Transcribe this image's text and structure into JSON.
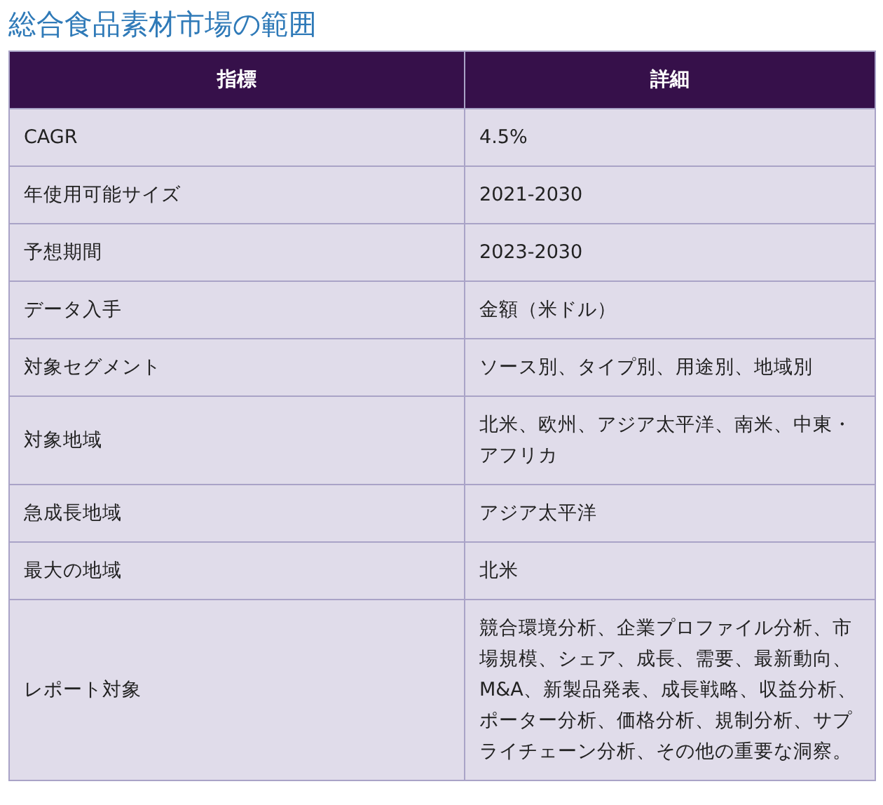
{
  "title": "総合食品素材市場の範囲",
  "table": {
    "columns": [
      "指標",
      "詳細"
    ],
    "rows": [
      [
        "CAGR",
        "4.5%"
      ],
      [
        "年使用可能サイズ",
        "2021-2030"
      ],
      [
        "予想期間",
        "2023-2030"
      ],
      [
        "データ入手",
        "金額（米ドル）"
      ],
      [
        "対象セグメント",
        "ソース別、タイプ別、用途別、地域別"
      ],
      [
        "対象地域",
        "北米、欧州、アジア太平洋、南米、中東・アフリカ"
      ],
      [
        "急成長地域",
        "アジア太平洋"
      ],
      [
        "最大の地域",
        "北米"
      ],
      [
        "レポート対象",
        "競合環境分析、企業プロファイル分析、市場規模、シェア、成長、需要、最新動向、M&A、新製品発表、成長戦略、収益分析、ポーター分析、価格分析、規制分析、サプライチェーン分析、その他の重要な洞察。"
      ]
    ]
  }
}
